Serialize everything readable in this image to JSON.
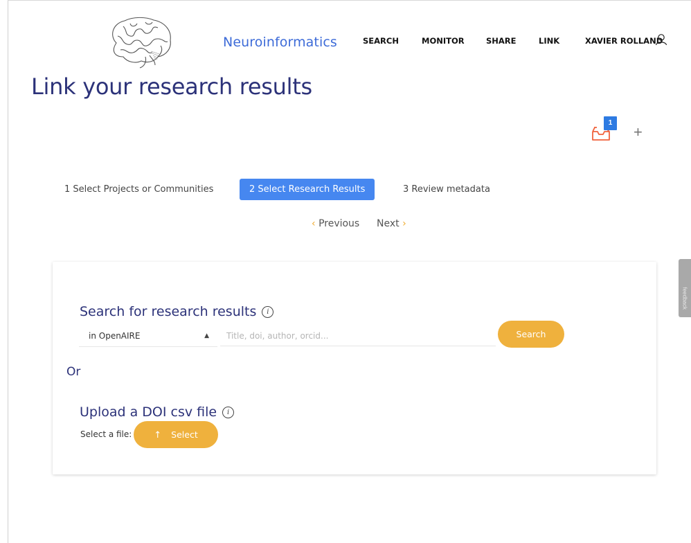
{
  "header": {
    "brand": "Neuroinformatics",
    "nav": [
      "SEARCH",
      "MONITOR",
      "SHARE",
      "LINK"
    ],
    "user_name": "XAVIER ROLLAND"
  },
  "page": {
    "title": "Link your research results"
  },
  "basket": {
    "count": "1",
    "add_symbol": "+"
  },
  "steps": [
    "1 Select Projects or Communities",
    "2 Select Research Results",
    "3 Review metadata"
  ],
  "pager": {
    "previous": "Previous",
    "next": "Next"
  },
  "search_section": {
    "title": "Search for research results",
    "source": "in OpenAIRE",
    "placeholder": "Title, doi, author, orcid...",
    "search_button": "Search"
  },
  "or_label": "Or",
  "upload_section": {
    "title": "Upload a DOI csv file",
    "file_label": "Select a file:",
    "select_button": "Select"
  },
  "feedback": {
    "label": "feedback"
  },
  "colors": {
    "brand_blue": "#3d6bd8",
    "title_navy": "#2c3279",
    "active_step": "#4687f0",
    "accent_orange": "#efb13d",
    "basket_red": "#f0623c"
  },
  "icons": [
    "brain-logo-icon",
    "user-icon",
    "basket-icon",
    "plus-icon",
    "info-icon",
    "upload-arrow-icon"
  ]
}
